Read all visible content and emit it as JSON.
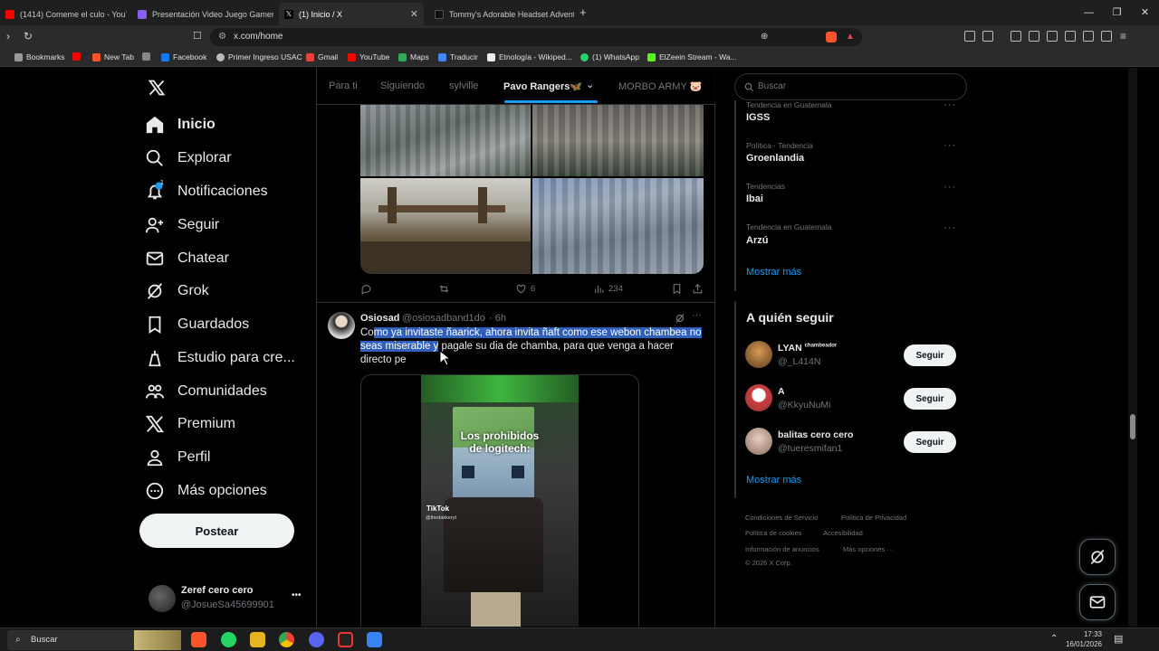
{
  "browser": {
    "tabs": [
      {
        "title": "(1414) Comeme el culo - YouTube",
        "color": "#ff0000"
      },
      {
        "title": "Presentación Video Juego Gamer Vi...",
        "color": "#8b5cf6"
      },
      {
        "title": "(1) Inicio / X",
        "color": "#ffffff"
      },
      {
        "title": "Tommy's Adorable Headset Adventu...",
        "color": "#111111"
      }
    ],
    "new_tab": "+",
    "url": "x.com/home",
    "bookmarks": [
      "Bookmarks",
      "New Tab",
      "Facebook",
      "Primer Ingreso USAC",
      "Gmail",
      "YouTube",
      "Maps",
      "Traducir",
      "Etnología - Wikiped...",
      "(1) WhatsApp",
      "ElZeein Stream - Wa..."
    ]
  },
  "sidebar": {
    "logo": "x-logo",
    "items": [
      {
        "label": "Inicio",
        "icon": "home-icon"
      },
      {
        "label": "Explorar",
        "icon": "search-icon"
      },
      {
        "label": "Notificaciones",
        "icon": "bell-icon"
      },
      {
        "label": "Seguir",
        "icon": "add-person-icon"
      },
      {
        "label": "Chatear",
        "icon": "mail-icon"
      },
      {
        "label": "Grok",
        "icon": "grok-icon"
      },
      {
        "label": "Guardados",
        "icon": "bookmark-icon"
      },
      {
        "label": "Estudio para cre...",
        "icon": "studio-icon"
      },
      {
        "label": "Comunidades",
        "icon": "people-icon"
      },
      {
        "label": "Premium",
        "icon": "x-icon"
      },
      {
        "label": "Perfil",
        "icon": "person-icon"
      },
      {
        "label": "Más opciones",
        "icon": "more-circle-icon"
      }
    ],
    "notif_badge": "1",
    "post_button": "Postear",
    "account": {
      "name": "Zeref cero cero",
      "handle": "@JosueSa45699901",
      "more": "•••"
    }
  },
  "timeline": {
    "tabs": [
      "Para ti",
      "Siguiendo",
      "sylville",
      "Pavo Rangers🦋",
      "MORBO ARMY 🐷"
    ],
    "active_tab": "Pavo Rangers🦋",
    "prev_post_actions": {
      "reply": "",
      "repost": "",
      "likes": "6",
      "views": "234"
    },
    "post": {
      "name": "Osiosad",
      "handle": "@osiosadband1do",
      "time": "· 6h",
      "text_selected": "mo ya invitaste ñaarick, ahora invita ñaft como ese webon chambea no seas miserable y",
      "text_prefix": "Co",
      "text_rest": " pagale su dia de chamba, para que venga a hacer directo pe",
      "video_caption_1": "Los prohibidos",
      "video_caption_2": "de logitech:",
      "watermark": "TikTok",
      "watermark_user": "@thedakkeryt"
    }
  },
  "right": {
    "search_placeholder": "Buscar",
    "trends": [
      {
        "meta": "Tendencia en Guatemala",
        "name": "IGSS"
      },
      {
        "meta": "Política · Tendencia",
        "name": "Groenlandia"
      },
      {
        "meta": "Tendencias",
        "name": "Ibai"
      },
      {
        "meta": "Tendencia en Guatemala",
        "name": "Arzú"
      }
    ],
    "show_more": "Mostrar más",
    "who_to_follow_title": "A quién seguir",
    "follow": [
      {
        "name": "LYAN",
        "tag": "chambeador",
        "handle": "@_L414N",
        "avatar_color": "#5a3a20"
      },
      {
        "name": "A",
        "tag": "",
        "handle": "@KkyuNuMi",
        "avatar_color": "#c84040"
      },
      {
        "name": "balitas cero cero",
        "tag": "",
        "handle": "@tueresmifan1",
        "avatar_color": "#8a6a60"
      }
    ],
    "follow_label": "Seguir",
    "show_more_2": "Mostrar más",
    "footer": [
      "Condiciones de Servicio",
      "Política de Privacidad",
      "Política de cookies",
      "Accesibilidad",
      "Información de anuncios",
      "Más opciones ···",
      "© 2026 X Corp."
    ]
  },
  "taskbar": {
    "search": "Buscar",
    "time": "17:33",
    "date": "16/01/2026"
  }
}
